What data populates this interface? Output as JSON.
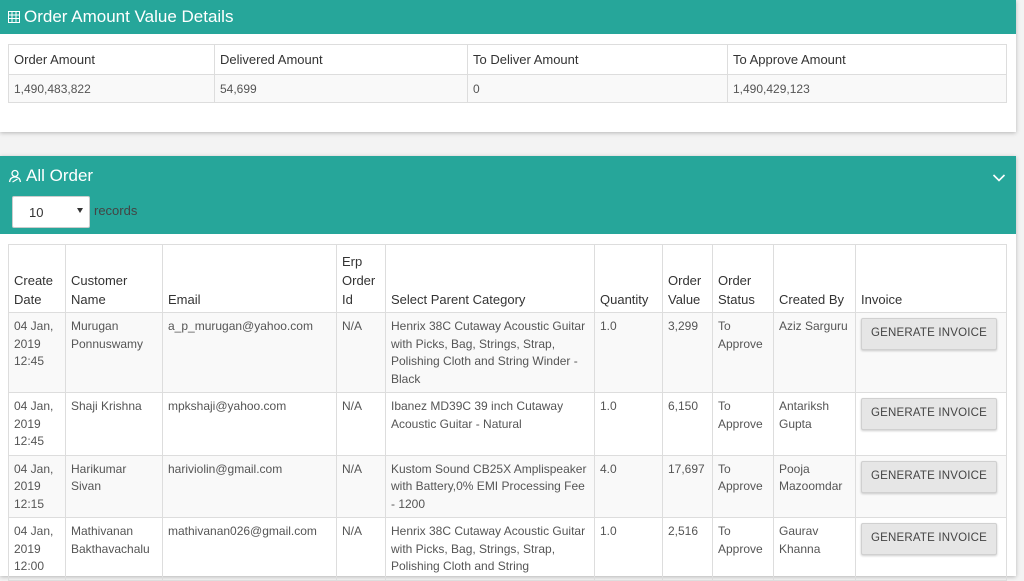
{
  "summary": {
    "title": "Order Amount Value Details",
    "headers": [
      "Order Amount",
      "Delivered Amount",
      "To Deliver Amount",
      "To Approve Amount"
    ],
    "values": [
      "1,490,483,822",
      "54,699",
      "0",
      "1,490,429,123"
    ]
  },
  "orders": {
    "title": "All Order",
    "page_size": "10",
    "records_label": "records",
    "headers": [
      "Create Date",
      "Customer Name",
      "Email",
      "Erp Order Id",
      "Select Parent Category",
      "Quantity",
      "Order Value",
      "Order Status",
      "Created By",
      "Invoice"
    ],
    "rows": [
      {
        "date": "04 Jan, 2019 12:45",
        "customer": "Murugan Ponnuswamy",
        "email": "a_p_murugan@yahoo.com",
        "erp": "N/A",
        "category": "Henrix 38C Cutaway Acoustic Guitar with Picks, Bag, Strings, Strap, Polishing Cloth and String Winder - Black",
        "quantity": "1.0",
        "value": "3,299",
        "status": "To Approve",
        "created_by": "Aziz Sarguru",
        "invoice_label": "GENERATE INVOICE"
      },
      {
        "date": "04 Jan, 2019 12:45",
        "customer": "Shaji Krishna",
        "email": "mpkshaji@yahoo.com",
        "erp": "N/A",
        "category": "Ibanez MD39C 39 inch Cutaway Acoustic Guitar - Natural",
        "quantity": "1.0",
        "value": "6,150",
        "status": "To Approve",
        "created_by": "Antariksh Gupta",
        "invoice_label": "GENERATE INVOICE"
      },
      {
        "date": "04 Jan, 2019 12:15",
        "customer": "Harikumar Sivan",
        "email": "hariviolin@gmail.com",
        "erp": "N/A",
        "category": "Kustom Sound CB25X Amplispeaker with Battery,0% EMI Processing Fee - 1200",
        "quantity": "4.0",
        "value": "17,697",
        "status": "To Approve",
        "created_by": "Pooja Mazoomdar",
        "invoice_label": "GENERATE INVOICE"
      },
      {
        "date": "04 Jan, 2019 12:00",
        "customer": "Mathivanan Bakthavachalu",
        "email": "mathivanan026@gmail.com",
        "erp": "N/A",
        "category": "Henrix 38C Cutaway Acoustic Guitar with Picks, Bag, Strings, Strap, Polishing Cloth and String",
        "quantity": "1.0",
        "value": "2,516",
        "status": "To Approve",
        "created_by": "Gaurav Khanna",
        "invoice_label": "GENERATE INVOICE"
      }
    ]
  },
  "colors": {
    "accent": "#26a69a"
  },
  "icons": {
    "summary": "table-icon",
    "orders": "user-icon",
    "toggle": "chevron-down-icon"
  }
}
